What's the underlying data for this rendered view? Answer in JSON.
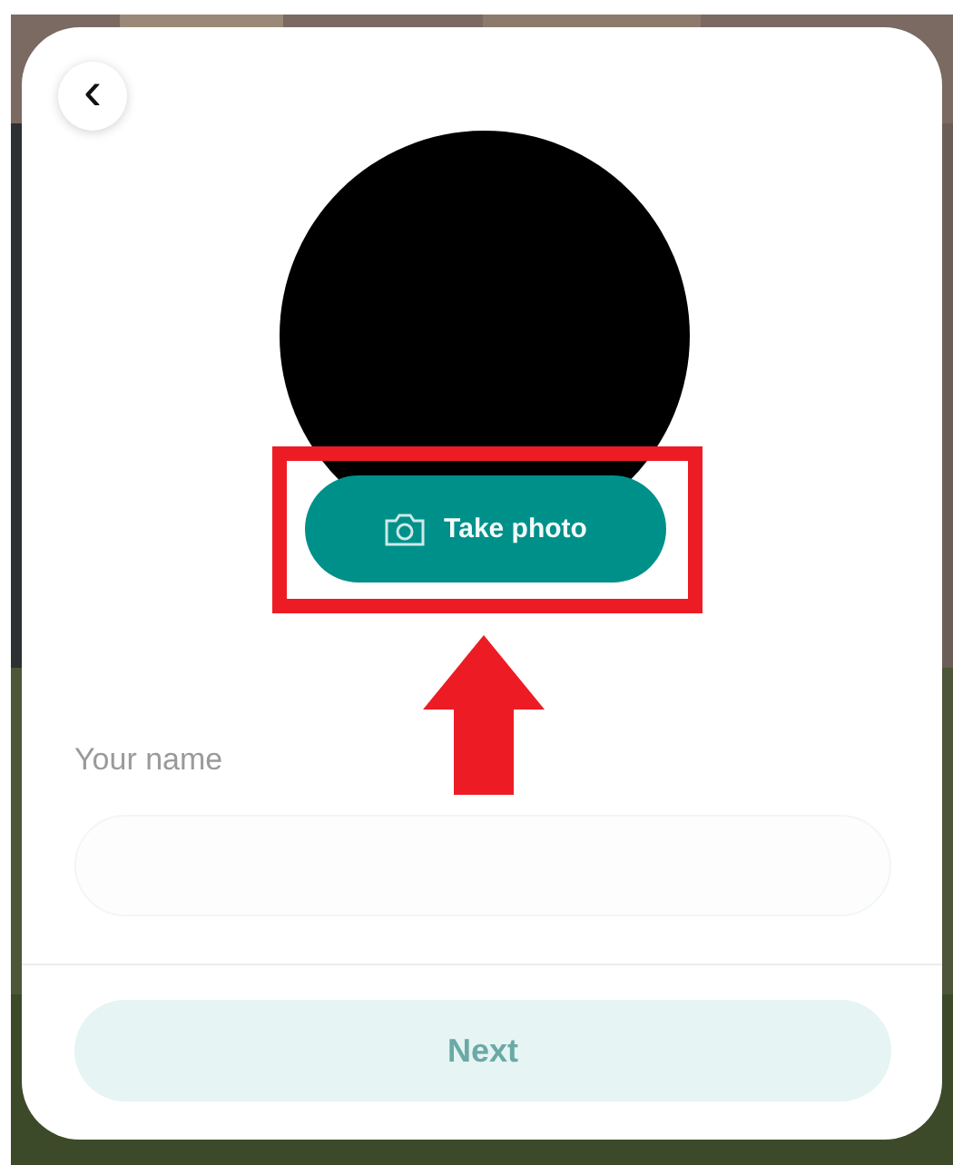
{
  "back_button": {
    "label": "‹"
  },
  "take_photo_button": {
    "label": "Take photo"
  },
  "name_field": {
    "label": "Your name"
  },
  "next_button": {
    "label": "Next",
    "disabled": true
  }
}
